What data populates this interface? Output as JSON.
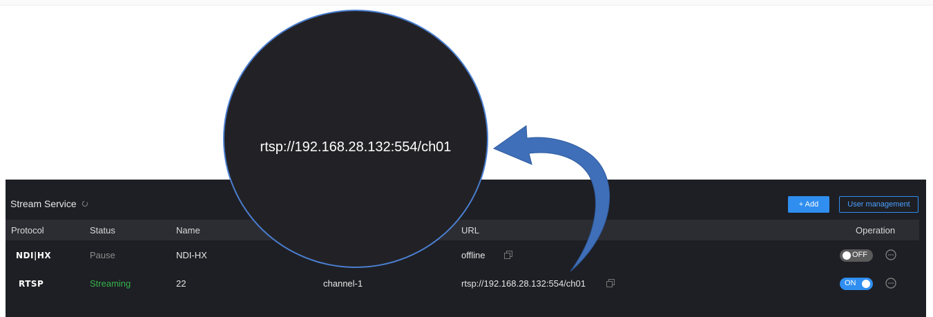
{
  "callout": {
    "text": "rtsp://192.168.28.132:554/ch01"
  },
  "header": {
    "title": "Stream Service",
    "add_label": "+ Add",
    "user_mgmt_label": "User management"
  },
  "columns": {
    "protocol": "Protocol",
    "status": "Status",
    "name": "Name",
    "url": "URL",
    "operation": "Operation"
  },
  "rows": [
    {
      "protocol": "NDI|HX",
      "status": "Pause",
      "name": "NDI-HX",
      "channel": "",
      "url": "offline",
      "toggle": "OFF"
    },
    {
      "protocol": "RTSP",
      "status": "Streaming",
      "name": "22",
      "channel": "channel-1",
      "url": "rtsp://192.168.28.132:554/ch01",
      "toggle": "ON"
    }
  ],
  "colors": {
    "accent": "#2f8ef0",
    "streaming": "#36b24a",
    "panel": "#1e1f24",
    "arrow": "#3f6fb8"
  },
  "icons": [
    "refresh-icon",
    "copy-icon",
    "more-icon",
    "arrow-icon"
  ]
}
